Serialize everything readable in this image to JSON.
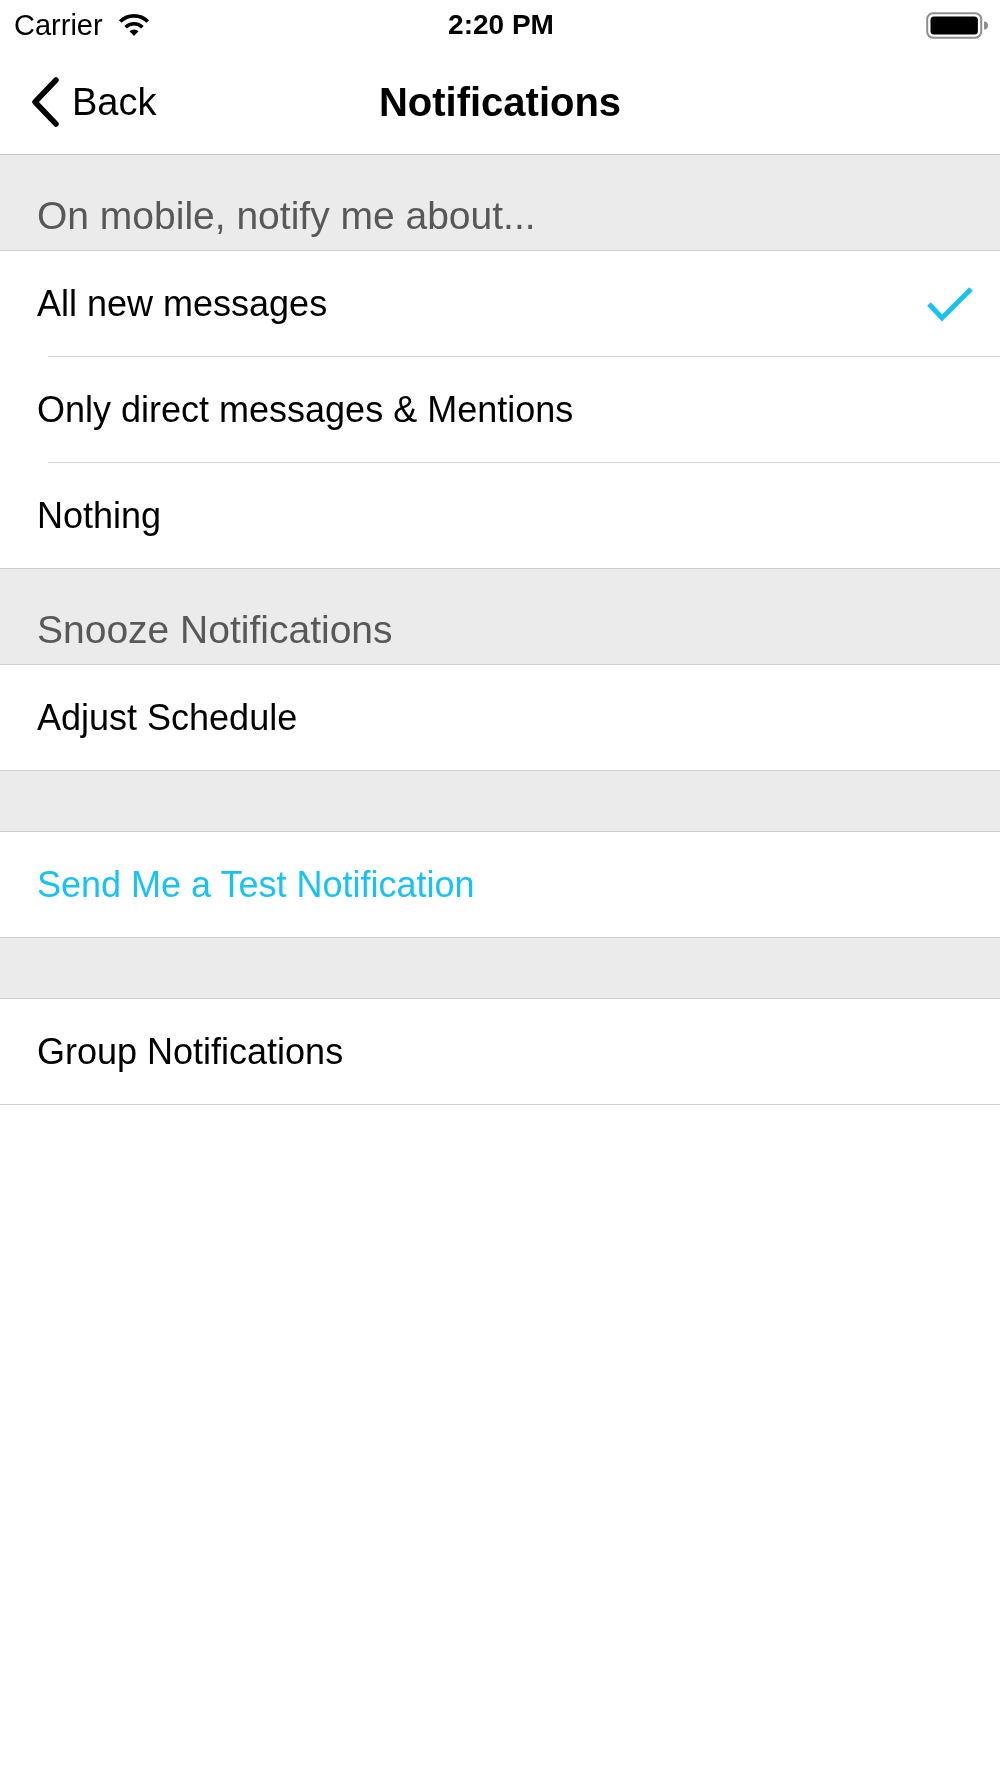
{
  "status_bar": {
    "carrier": "Carrier",
    "time": "2:20 PM"
  },
  "nav_bar": {
    "back": "Back",
    "title": "Notifications"
  },
  "sections": [
    {
      "header": "On mobile, notify me about...",
      "rows": [
        {
          "label": "All new messages",
          "kind": "option",
          "selected": true
        },
        {
          "label": "Only direct messages & Mentions",
          "kind": "option",
          "selected": false
        },
        {
          "label": "Nothing",
          "kind": "option",
          "selected": false
        }
      ]
    },
    {
      "header": "Snooze Notifications",
      "rows": [
        {
          "label": "Adjust Schedule",
          "kind": "item"
        }
      ]
    },
    {
      "rows": [
        {
          "label": "Send Me a Test Notification",
          "kind": "action"
        }
      ]
    },
    {
      "rows": [
        {
          "label": "Group Notifications",
          "kind": "item"
        }
      ]
    }
  ]
}
